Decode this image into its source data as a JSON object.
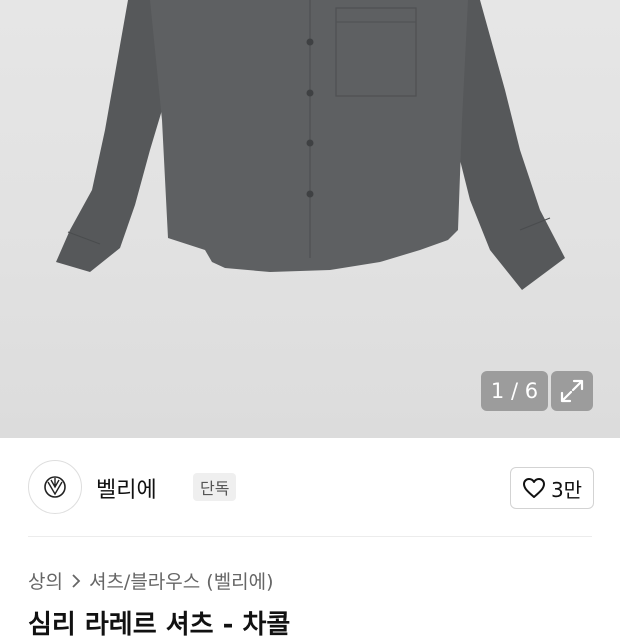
{
  "gallery": {
    "pager": "1 / 6",
    "expand_icon": "expand-icon"
  },
  "brand": {
    "name": "벨리에",
    "badge": "단독",
    "logo_icon": "brand-logo-icon"
  },
  "like": {
    "count": "3만",
    "icon": "heart-outline-icon"
  },
  "breadcrumb": {
    "category": "상의",
    "separator_icon": "chevron-right-icon",
    "subcategory": "셔츠/블라우스 (벨리에)"
  },
  "product": {
    "title": "심리 라레르 셔츠 - 차콜"
  },
  "colors": {
    "shirt": "#5a5c5d",
    "gallery_bg": "#e3e3e3",
    "overlay": "#9c9c9c"
  }
}
